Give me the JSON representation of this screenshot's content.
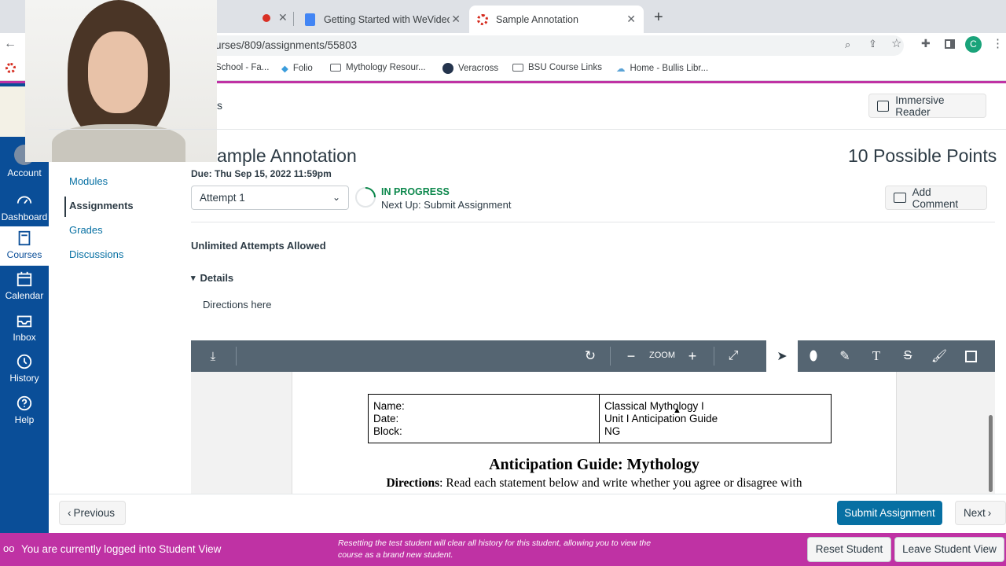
{
  "browser": {
    "tabs": [
      {
        "title": "Getting Started with WeVideo",
        "title_shown": "Getting Started with WeVideo ("
      },
      {
        "title": "Sample Annotation"
      }
    ],
    "url": "urses/809/assignments/55803",
    "bookmarks": [
      "School - Fa...",
      "Folio",
      "Mythology Resour...",
      "Veracross",
      "BSU Course Links",
      "Home - Bullis Libr..."
    ],
    "profile_initial": "C"
  },
  "global_nav": [
    {
      "label": "Account"
    },
    {
      "label": "Dashboard"
    },
    {
      "label": "Courses"
    },
    {
      "label": "Calendar"
    },
    {
      "label": "Inbox"
    },
    {
      "label": "History"
    },
    {
      "label": "Help"
    }
  ],
  "breadcrumb_fragment": "s",
  "immersive_reader": "Immersive Reader",
  "course_nav": [
    "Modules",
    "Assignments",
    "Grades",
    "Discussions"
  ],
  "assignment": {
    "title": "ample Annotation",
    "points": "10 Possible Points",
    "due": "Due: Thu Sep 15, 2022 11:59pm",
    "attempt": "Attempt 1",
    "status": "IN PROGRESS",
    "next_up": "Next Up: Submit Assignment",
    "add_comment": "Add Comment",
    "attempts_allowed": "Unlimited Attempts Allowed",
    "details_label": "Details",
    "directions": "Directions here"
  },
  "pdf_toolbar": {
    "zoom_label": "ZOOM"
  },
  "pdf": {
    "table_left": [
      "Name:",
      "Date:",
      "Block:"
    ],
    "table_right": [
      "Classical Mythology I",
      "Unit I Anticipation Guide",
      "NG"
    ],
    "heading": "Anticipation Guide: Mythology",
    "directions_label": "Directions",
    "directions_text": ": Read each statement below and write whether you agree or disagree with"
  },
  "footer": {
    "previous": "Previous",
    "submit": "Submit Assignment",
    "next": "Next"
  },
  "student_view": {
    "message": "You are currently logged into Student View",
    "reset_note_line1": "Resetting the test student will clear all history for this student, allowing you to view the",
    "reset_note_line2": "course as a brand new student.",
    "reset_button": "Reset Student",
    "leave_button": "Leave Student View"
  },
  "colors": {
    "canvas_nav": "#0a4e98",
    "student_bar": "#bf32a4",
    "submit_button": "#0770a3",
    "status_green": "#0b874b",
    "pdf_toolbar": "#556572"
  }
}
